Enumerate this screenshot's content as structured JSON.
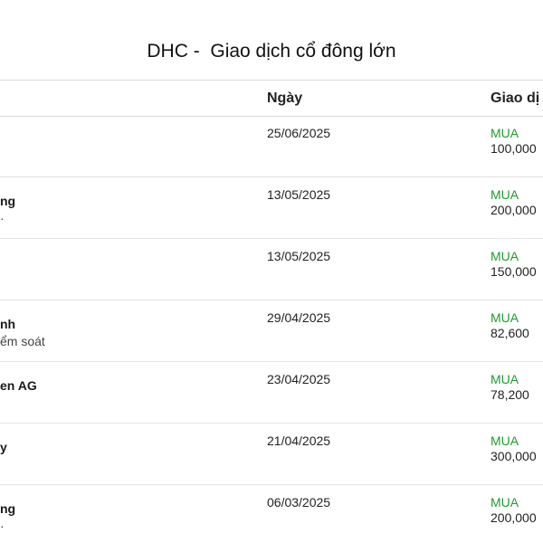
{
  "title": "DHC -  Giao dịch cổ đông lớn",
  "table": {
    "headers": {
      "date": "Ngày",
      "trade": "Giao dị"
    },
    "rows": [
      {
        "name": "",
        "role": "",
        "date": "25/06/2025",
        "action": "MUA",
        "qty": "100,000"
      },
      {
        "name": "ng",
        "role": "·",
        "date": "13/05/2025",
        "action": "MUA",
        "qty": "200,000"
      },
      {
        "name": "",
        "role": "",
        "date": "13/05/2025",
        "action": "MUA",
        "qty": "150,000"
      },
      {
        "name": "nh",
        "role": "ểm soát",
        "date": "29/04/2025",
        "action": "MUA",
        "qty": "82,600"
      },
      {
        "name": "en AG",
        "role": "",
        "date": "23/04/2025",
        "action": "MUA",
        "qty": "78,200"
      },
      {
        "name": "y",
        "role": "",
        "date": "21/04/2025",
        "action": "MUA",
        "qty": "300,000"
      },
      {
        "name": "ng",
        "role": "·",
        "date": "06/03/2025",
        "action": "MUA",
        "qty": "200,000"
      }
    ]
  },
  "colors": {
    "buy": "#1f9a2e",
    "divider": "#e3e3e3"
  }
}
